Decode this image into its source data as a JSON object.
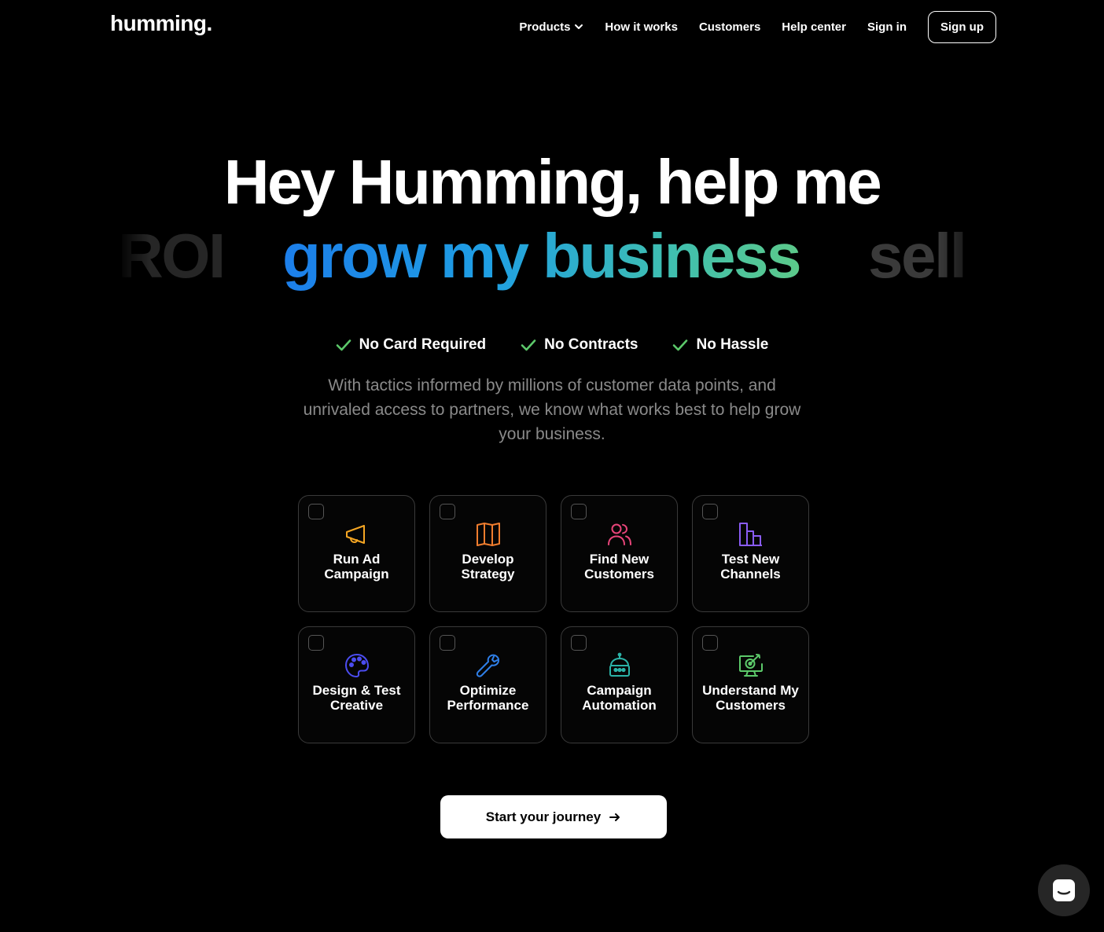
{
  "brand": {
    "logo": "humming."
  },
  "nav": {
    "products": "Products",
    "how_it_works": "How it works",
    "customers": "Customers",
    "help_center": "Help center",
    "sign_in": "Sign in",
    "sign_up": "Sign up"
  },
  "hero": {
    "title": "Hey Humming, help me",
    "rotator_prev": "ROI",
    "rotator_current": "grow my business",
    "rotator_next": "sell",
    "gradient_colors": [
      "#1c7eea",
      "#1f9fe3",
      "#3fbfb0",
      "#5cc98a"
    ]
  },
  "checks": [
    {
      "label": "No Card Required"
    },
    {
      "label": "No Contracts"
    },
    {
      "label": "No Hassle"
    }
  ],
  "subtitle": "With tactics informed by millions of customer data points, and unrivaled access to partners, we know what works best to help grow your business.",
  "cards": [
    {
      "label": "Run Ad Campaign",
      "icon": "megaphone-icon",
      "color": "#f5a623"
    },
    {
      "label": "Develop Strategy",
      "icon": "map-icon",
      "color": "#f07d2e"
    },
    {
      "label": "Find New Customers",
      "icon": "users-icon",
      "color": "#e8457a"
    },
    {
      "label": "Test New Channels",
      "icon": "bar-chart-icon",
      "color": "#8a5cf5"
    },
    {
      "label": "Design & Test Creative",
      "icon": "palette-icon",
      "color": "#4b4cf0"
    },
    {
      "label": "Optimize Performance",
      "icon": "wrench-icon",
      "color": "#2f7fe8"
    },
    {
      "label": "Campaign Automation",
      "icon": "robot-icon",
      "color": "#2bb3a8"
    },
    {
      "label": "Understand My Customers",
      "icon": "monitor-target-icon",
      "color": "#5cc96a"
    }
  ],
  "cta": {
    "label": "Start your journey"
  },
  "colors": {
    "check_green": "#5cc96a",
    "background": "#000000"
  }
}
